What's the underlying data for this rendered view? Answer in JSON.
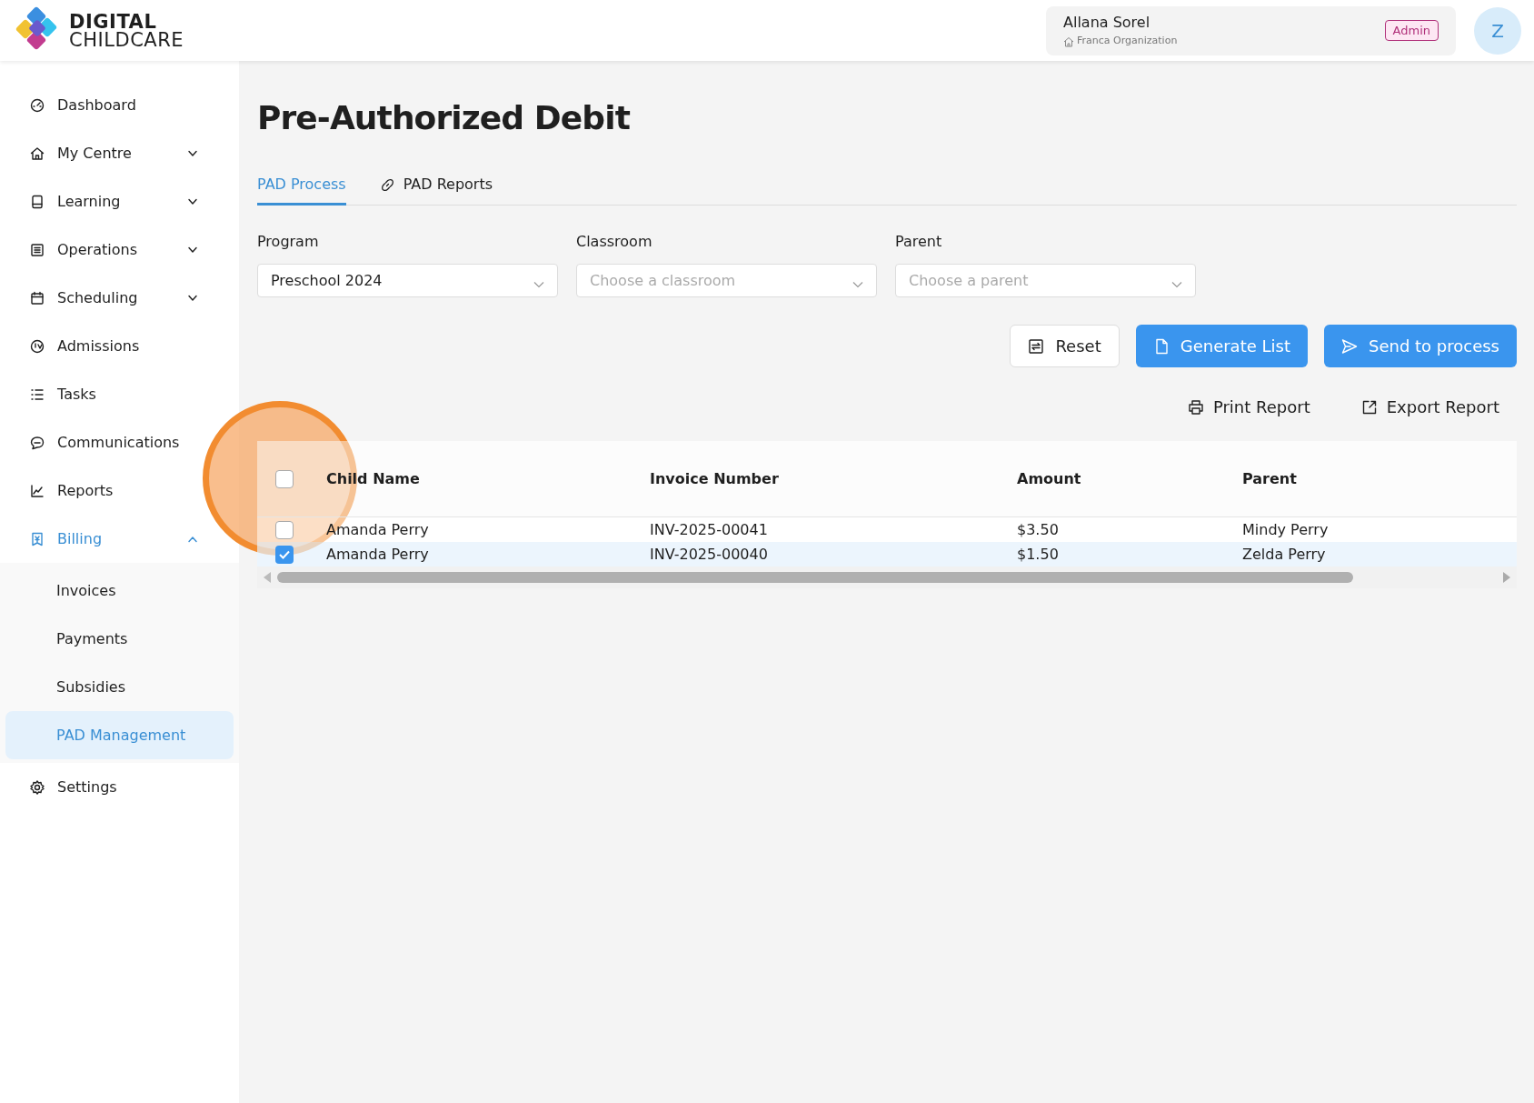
{
  "brand": {
    "line_1": "DIGITAL",
    "line_2": "CHILDCARE"
  },
  "user": {
    "name": "Allana Sorel",
    "organization": "Franca Organization",
    "role": "Admin",
    "avatar": "Z"
  },
  "sidebar": {
    "items": [
      {
        "label": "Dashboard",
        "selected": false
      },
      {
        "label": "My Centre",
        "selected": false,
        "expanded": false
      },
      {
        "label": "Learning",
        "selected": false,
        "expanded": false
      },
      {
        "label": "Operations",
        "selected": false,
        "expanded": false
      },
      {
        "label": "Scheduling",
        "selected": false,
        "expanded": false
      },
      {
        "label": "Admissions",
        "selected": false
      },
      {
        "label": "Tasks",
        "selected": false
      },
      {
        "label": "Communications",
        "selected": false
      },
      {
        "label": "Reports",
        "selected": false
      },
      {
        "label": "Billing",
        "selected": true,
        "expanded": true,
        "children": [
          {
            "label": "Invoices",
            "selected": false
          },
          {
            "label": "Payments",
            "selected": false
          },
          {
            "label": "Subsidies",
            "selected": false
          },
          {
            "label": "PAD Management",
            "selected": true
          }
        ]
      },
      {
        "label": "Settings",
        "selected": false
      }
    ]
  },
  "page_title": "Pre-Authorized Debit",
  "tabs": [
    {
      "label": "PAD Process",
      "selected": true
    },
    {
      "label": "PAD Reports",
      "selected": false
    }
  ],
  "filters": [
    {
      "label": "Program",
      "value": "Preschool 2024"
    },
    {
      "label": "Classroom",
      "placeholder": "Choose a classroom"
    },
    {
      "label": "Parent",
      "placeholder": "Choose a parent"
    }
  ],
  "actions": [
    {
      "label": "Reset",
      "kind": "outline"
    },
    {
      "label": "Generate List",
      "kind": "primary"
    },
    {
      "label": "Send to process",
      "kind": "primary"
    }
  ],
  "report_links": [
    "Print Report",
    "Export Report"
  ],
  "table": {
    "all_checked": false,
    "columns": [
      "Child Name",
      "Invoice Number",
      "Amount",
      "Parent"
    ],
    "rows": [
      {
        "checked": false,
        "cells": [
          "Amanda Perry",
          "INV-2025-00041",
          "$3.50",
          "Mindy Perry"
        ]
      },
      {
        "checked": true,
        "cells": [
          "Amanda Perry",
          "INV-2025-00040",
          "$1.50",
          "Zelda Perry"
        ]
      }
    ]
  }
}
